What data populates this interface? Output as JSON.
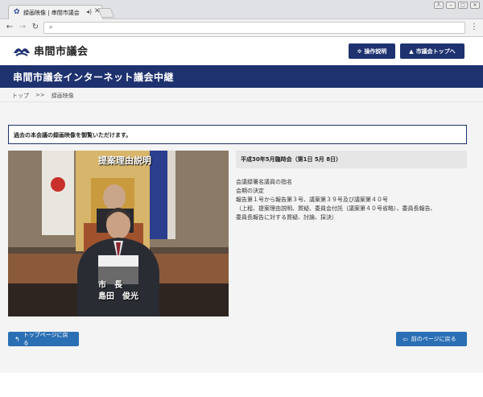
{
  "browser": {
    "tab_title": "録画映像 | 串間市議会",
    "tab_audio_icon": "speaker-icon",
    "tab_close": "✕",
    "window_buttons": [
      "人",
      "−",
      "□",
      "✕"
    ],
    "omnibox_icon": "search-icon",
    "menu_icon": "⋮"
  },
  "header": {
    "logo_text": "串間市議会",
    "guide_button": "操作説明",
    "council_top_button": "市議会トップへ"
  },
  "banner": {
    "title": "串間市議会インターネット議会中継"
  },
  "breadcrumb": {
    "home": "トップ",
    "separator": ">>",
    "current": "録画映像"
  },
  "notice": {
    "text": "過去の本会議の録画映像を御覧いただけます。"
  },
  "video": {
    "caption_top": "提案理由説明",
    "caption_role": "市　長",
    "caption_name": "島田　俊光"
  },
  "session": {
    "title": "平成30年5月臨時会（第1日 5月 8日）",
    "agenda": [
      "会議録署名議員の指名",
      "会期の決定",
      "報告第１号から報告第３号、議案第３９号及び議案第４０号",
      "（上程、提案理由説明、質疑、委員会付託（議案第４０号省略）、委員長報告、",
      "委員長報告に対する質疑、討論、採決）"
    ]
  },
  "footer_buttons": {
    "back_to_top": "トップページに戻る",
    "back_to_prev": "前のページに戻る"
  },
  "colors": {
    "brand_navy": "#1e3270",
    "button_blue": "#2a6fb4",
    "content_bg": "#f4f4f4"
  }
}
